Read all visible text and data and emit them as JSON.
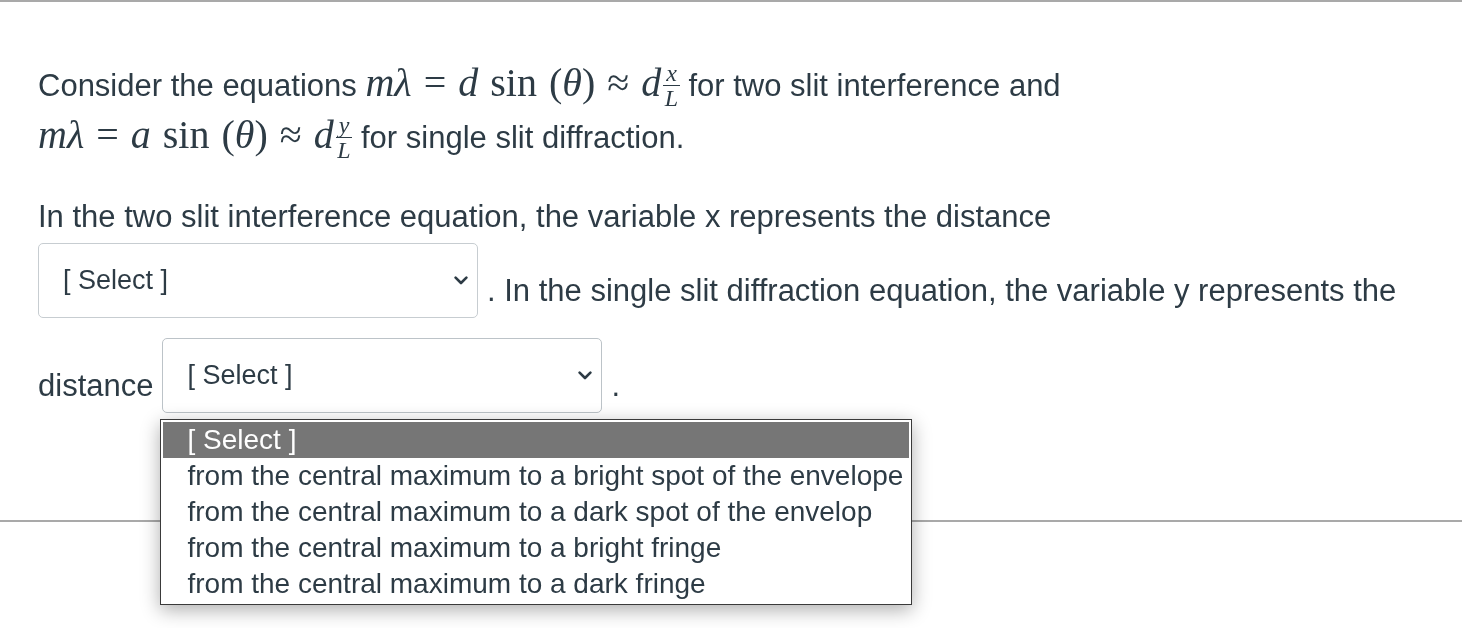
{
  "question": {
    "intro": [
      {
        "kind": "text",
        "text": "Consider the equations "
      },
      {
        "kind": "math",
        "expr": "*mλ* = *d* sin (*θ*) ≈ *d*",
        "numerator": "x",
        "denominator": "L"
      },
      {
        "kind": "text",
        "text": " for two slit interference and "
      },
      {
        "kind": "math",
        "expr": "*mλ* = *a* sin (*θ*) ≈ *d*",
        "numerator": "y",
        "denominator": "L"
      },
      {
        "kind": "text",
        "text": " for single slit diffraction."
      }
    ],
    "prompt": [
      {
        "kind": "text",
        "text": "In the two slit interference equation, the variable x represents the distance"
      },
      {
        "kind": "select",
        "value": "[ Select ]",
        "expanded": false
      },
      {
        "kind": "text",
        "text": ". In the single slit diffraction equation, the variable y represents the"
      },
      {
        "kind": "text",
        "text": "distance"
      },
      {
        "kind": "select",
        "value": "[ Select ]",
        "expanded": true,
        "options": [
          {
            "label": "[ Select ]",
            "selected": true
          },
          {
            "label": "from the central maximum to a bright spot of the envelope",
            "selected": false
          },
          {
            "label": "from the central maximum to a dark spot of the envelop",
            "selected": false
          },
          {
            "label": "from the central maximum to a bright fringe",
            "selected": false
          },
          {
            "label": "from the central maximum to a dark fringe",
            "selected": false
          }
        ]
      },
      {
        "kind": "text",
        "text": "."
      }
    ]
  }
}
